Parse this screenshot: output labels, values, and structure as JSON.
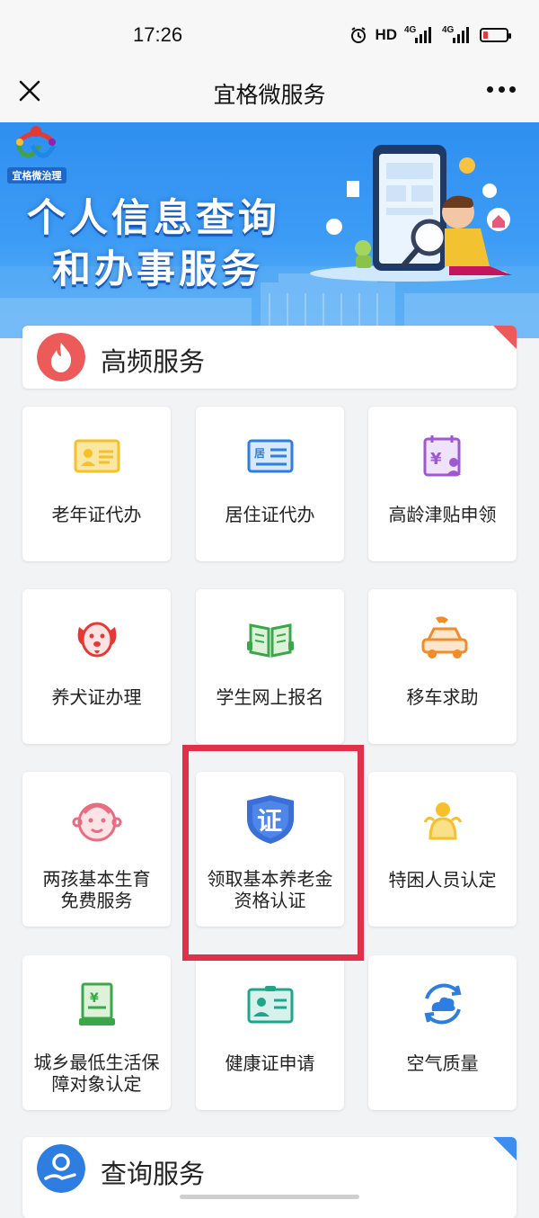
{
  "status_bar": {
    "time": "17:26",
    "hd_label": "HD",
    "network_labels": [
      "4G",
      "4G"
    ],
    "icons": [
      "alarm-icon",
      "signal-icon",
      "signal-icon",
      "battery-icon"
    ],
    "battery_level": 0.1,
    "battery_color": "#e53935"
  },
  "nav": {
    "title": "宜格微服务",
    "close_icon": "close-icon",
    "more_icon": "more-icon"
  },
  "banner": {
    "logo_text": "宜格微治理",
    "line1": "个人信息查询",
    "line2": "和办事服务"
  },
  "sections": {
    "high_freq": {
      "title": "高频服务",
      "icon": "fire-icon",
      "accent": "#ec5a5a"
    },
    "query": {
      "title": "查询服务",
      "icon": "user-hand-icon",
      "accent": "#3d8ef0"
    }
  },
  "tiles": [
    {
      "label": "老年证代办",
      "icon": "elder-card-icon"
    },
    {
      "label": "居住证代办",
      "icon": "residence-card-icon"
    },
    {
      "label": "高龄津贴申领",
      "icon": "allowance-icon"
    },
    {
      "label": "养犬证办理",
      "icon": "dog-icon"
    },
    {
      "label": "学生网上报名",
      "icon": "book-icon"
    },
    {
      "label": "移车求助",
      "icon": "car-phone-icon"
    },
    {
      "label_l1": "两孩基本生育",
      "label_l2": "免费服务",
      "icon": "baby-icon"
    },
    {
      "label_l1": "领取基本养老金",
      "label_l2": "资格认证",
      "icon": "certificate-shield-icon",
      "highlighted": true
    },
    {
      "label": "特困人员认定",
      "icon": "hardship-person-icon"
    },
    {
      "label_l1": "城乡最低生活保",
      "label_l2": "障对象认定",
      "icon": "document-stamp-icon"
    },
    {
      "label": "健康证申请",
      "icon": "health-card-icon"
    },
    {
      "label": "空气质量",
      "icon": "air-quality-icon"
    }
  ],
  "colors": {
    "highlight_box": "#e0304a",
    "banner_blue": "#2f8ff0"
  }
}
